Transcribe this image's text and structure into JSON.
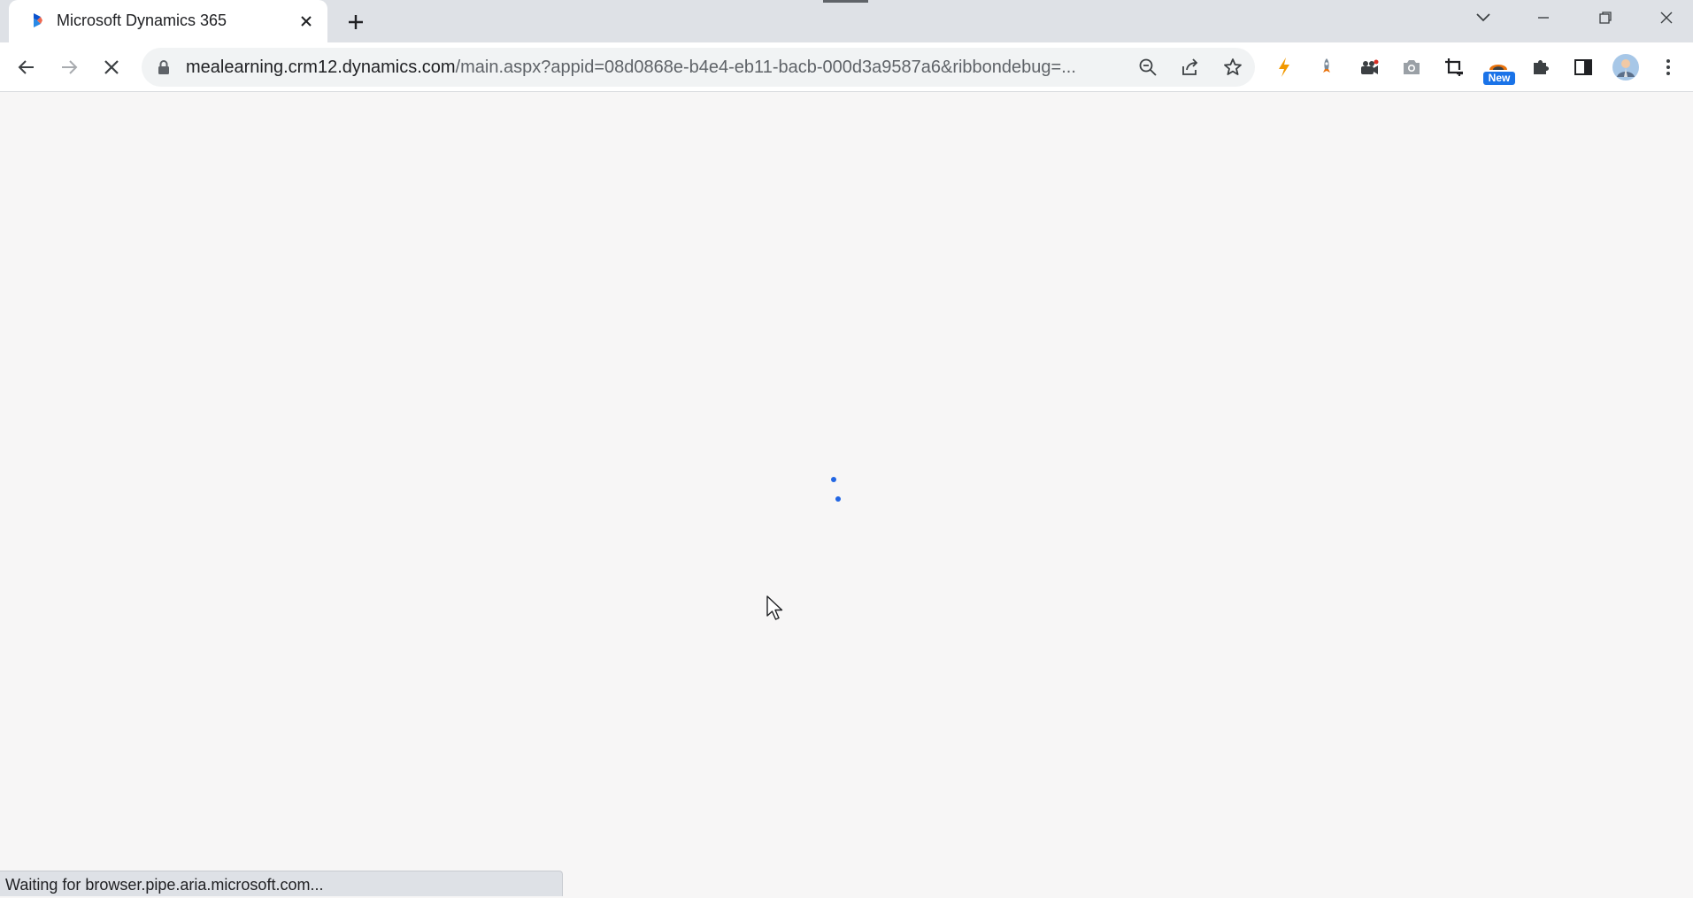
{
  "browser": {
    "tab": {
      "title": "Microsoft Dynamics 365"
    },
    "address_bar": {
      "host": "mealearning.crm12.dynamics.com",
      "path": "/main.aspx?appid=08d0868e-b4e4-eb11-bacb-000d3a9587a6&ribbondebug=..."
    },
    "extensions": {
      "new_badge": "New"
    },
    "status_text": "Waiting for browser.pipe.aria.microsoft.com..."
  },
  "colors": {
    "accent": "#2266e3",
    "page_background": "#f7f6f6",
    "tabstrip_background": "#dee1e6",
    "extension_bolt": "#f29900"
  }
}
